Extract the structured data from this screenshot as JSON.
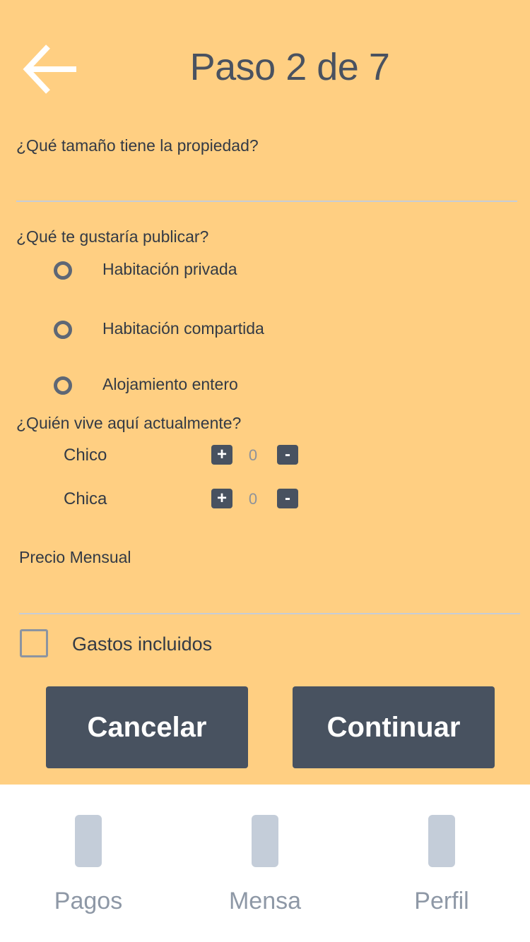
{
  "header": {
    "title": "Paso 2 de 7",
    "back_icon": "arrow-left-icon"
  },
  "form": {
    "size_question": "¿Qué tamaño tiene la propiedad?",
    "size_value": "",
    "publish_question": "¿Qué te gustaría publicar?",
    "publish_options": [
      {
        "label": "Habitación privada"
      },
      {
        "label": "Habitación compartida"
      },
      {
        "label": "Alojamiento entero"
      }
    ],
    "residents_question": "¿Quién vive aquí actualmente?",
    "residents": [
      {
        "label": "Chico",
        "plus": "+",
        "value": "0",
        "minus": "-"
      },
      {
        "label": "Chica",
        "plus": "+",
        "value": "0",
        "minus": "-"
      }
    ],
    "price_label": "Precio Mensual",
    "price_value": "",
    "expenses_label": "Gastos incluidos",
    "expenses_checked": false
  },
  "actions": {
    "cancel_label": "Cancelar",
    "continue_label": "Continuar"
  },
  "tabbar": {
    "items": [
      {
        "label": "Pagos",
        "icon": "pagos-icon"
      },
      {
        "label": "Mensa",
        "icon": "mensajes-icon"
      },
      {
        "label": "Perfil",
        "icon": "perfil-icon"
      }
    ]
  },
  "colors": {
    "background": "#ffcf82",
    "primary": "#485260",
    "tab_icon": "#c4cdd9",
    "tab_text": "#8e98a6"
  }
}
